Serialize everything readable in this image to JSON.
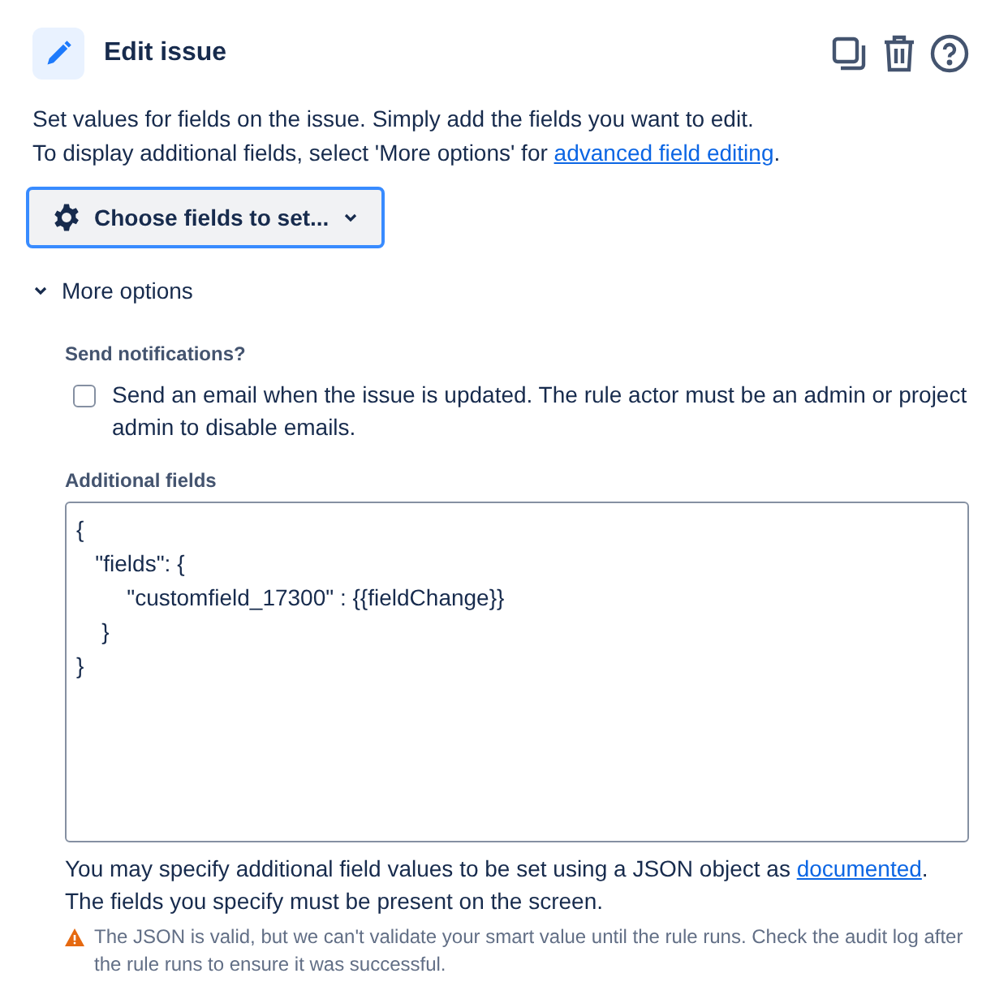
{
  "header": {
    "title": "Edit issue"
  },
  "description": {
    "line_1": "Set values for fields on the issue. Simply add the fields you want to edit.",
    "line_2_before": "To display additional fields, select 'More options' for ",
    "line_2_link": "advanced field editing",
    "line_2_after": "."
  },
  "choose_button": {
    "label": "Choose fields to set..."
  },
  "more_options": {
    "label": "More options",
    "expanded": true
  },
  "notifications": {
    "label": "Send notifications?",
    "checkbox_label": "Send an email when the issue is updated. The rule actor must be an admin or project admin to disable emails.",
    "checked": false
  },
  "additional_fields": {
    "label": "Additional fields",
    "value": "{\n   \"fields\": {\n        \"customfield_17300\" : {{fieldChange}}\n    }\n}"
  },
  "help": {
    "before": "You may specify additional field values to be set using a JSON object as ",
    "link": "documented",
    "after": ".",
    "line_2": "The fields you specify must be present on the screen."
  },
  "warning": {
    "text": "The JSON is valid, but we can't validate your smart value until the rule runs. Check the audit log after the rule runs to ensure it was successful."
  }
}
